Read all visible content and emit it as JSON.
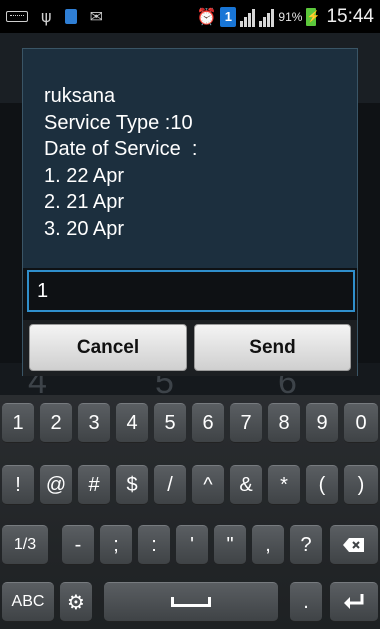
{
  "status_bar": {
    "battery_percent": "91%",
    "time": "15:44",
    "notification_badge": "1",
    "icons": [
      "keyboard-icon",
      "usb-icon",
      "sim-icon",
      "mail-icon",
      "alarm-icon",
      "signal-icon",
      "signal-icon",
      "battery-charging-icon"
    ]
  },
  "dialog": {
    "message_lines": [
      "ruksana",
      "Service Type :10",
      "Date of Service  :",
      "1. 22 Apr",
      "2. 21 Apr",
      "3. 20 Apr"
    ],
    "input_value": "1",
    "cancel_label": "Cancel",
    "send_label": "Send"
  },
  "keyboard": {
    "row1": [
      "1",
      "2",
      "3",
      "4",
      "5",
      "6",
      "7",
      "8",
      "9",
      "0"
    ],
    "row2": [
      "!",
      "@",
      "#",
      "$",
      "/",
      "^",
      "&",
      "*",
      "(",
      ")"
    ],
    "row3": [
      "1/3",
      "-",
      ";",
      ":",
      "'",
      "\"",
      ",",
      "?"
    ],
    "row4_left": "ABC",
    "row4_period": "."
  },
  "colors": {
    "dialog_bg": "#1c2f3e",
    "input_border": "#2f8fcc",
    "key_bg": "#4a4e52",
    "battery": "#5cc83c",
    "badge": "#1875d6"
  }
}
